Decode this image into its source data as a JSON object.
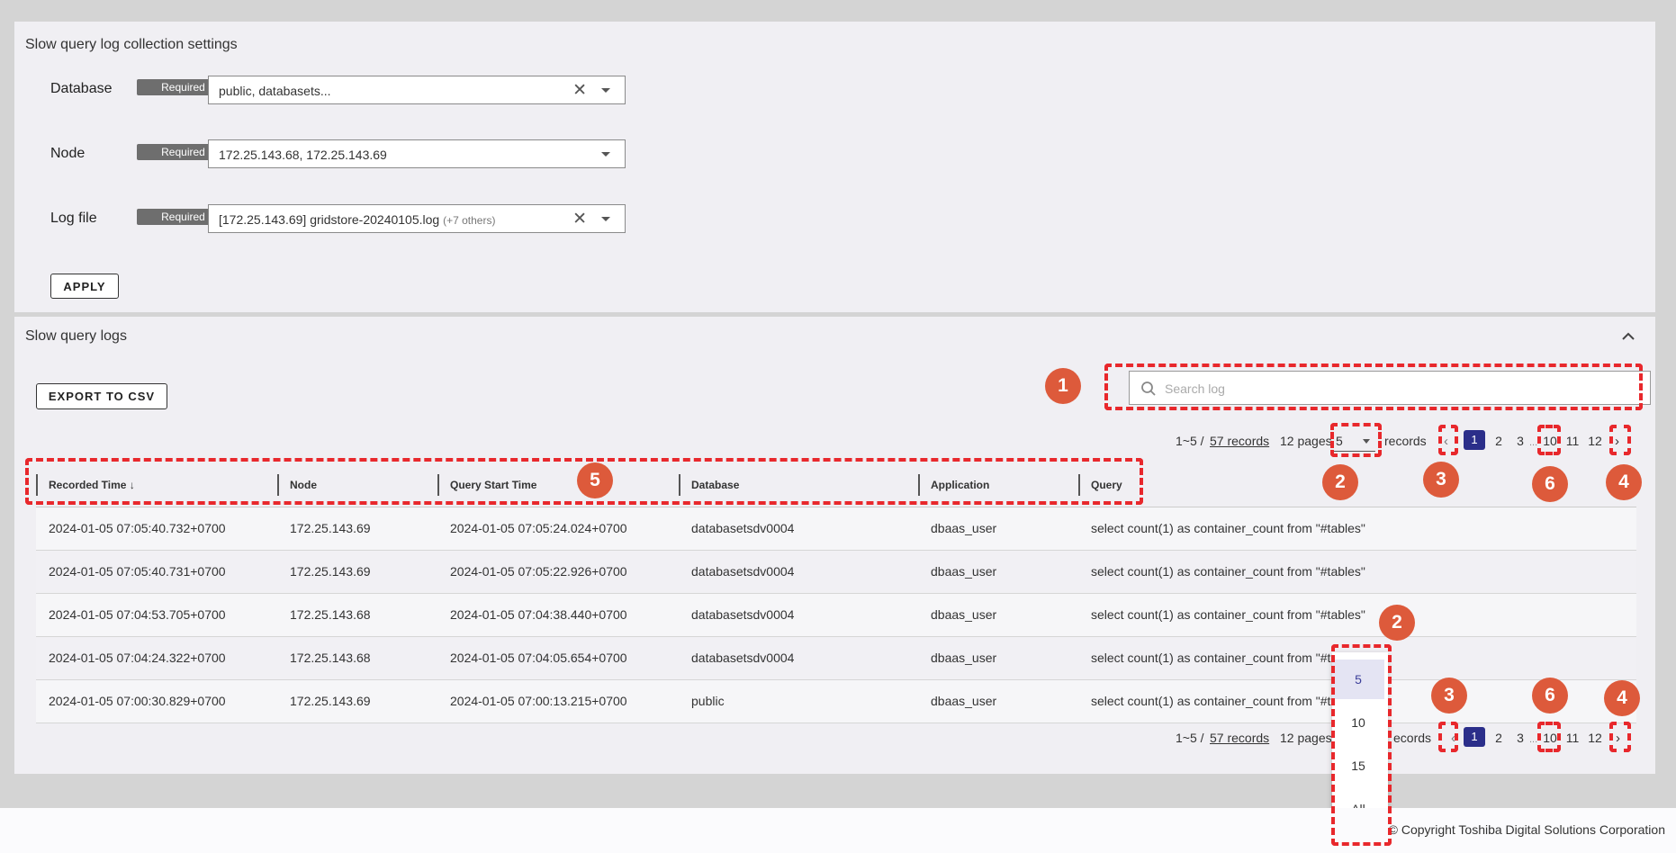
{
  "settings": {
    "title": "Slow query log collection settings",
    "required_badge": "Required",
    "database": {
      "label": "Database",
      "value": "public, databasets..."
    },
    "node": {
      "label": "Node",
      "value": "172.25.143.68, 172.25.143.69"
    },
    "logfile": {
      "label": "Log file",
      "value": "[172.25.143.69] gridstore-20240105.log",
      "extra": "(+7 others)"
    },
    "apply_label": "APPLY"
  },
  "logs": {
    "title": "Slow query logs",
    "export_label": "EXPORT TO CSV",
    "search_placeholder": "Search log",
    "pagination": {
      "range": "1~5 /",
      "records_link": "57 records",
      "pages": "12 pages",
      "page_size": "5",
      "records_label": "records",
      "pages_list": [
        "1",
        "2",
        "3",
        "...",
        "10",
        "11",
        "12"
      ],
      "current_page": "1"
    },
    "columns": [
      "Recorded Time",
      "Node",
      "Query Start Time",
      "Database",
      "Application",
      "Query"
    ],
    "sort_icon": "arrow-down-icon",
    "rows": [
      [
        "2024-01-05 07:05:40.732+0700",
        "172.25.143.69",
        "2024-01-05 07:05:24.024+0700",
        "databasetsdv0004",
        "dbaas_user",
        "select count(1) as container_count from \"#tables\""
      ],
      [
        "2024-01-05 07:05:40.731+0700",
        "172.25.143.69",
        "2024-01-05 07:05:22.926+0700",
        "databasetsdv0004",
        "dbaas_user",
        "select count(1) as container_count from \"#tables\""
      ],
      [
        "2024-01-05 07:04:53.705+0700",
        "172.25.143.68",
        "2024-01-05 07:04:38.440+0700",
        "databasetsdv0004",
        "dbaas_user",
        "select count(1) as container_count from \"#tables\""
      ],
      [
        "2024-01-05 07:04:24.322+0700",
        "172.25.143.68",
        "2024-01-05 07:04:05.654+0700",
        "databasetsdv0004",
        "dbaas_user",
        "select count(1) as container_count from \"#t"
      ],
      [
        "2024-01-05 07:00:30.829+0700",
        "172.25.143.69",
        "2024-01-05 07:00:13.215+0700",
        "public",
        "dbaas_user",
        "select count(1) as container_count from \"#t"
      ]
    ],
    "bottom_records_label": "ecords",
    "page_size_options": [
      "5",
      "10",
      "15",
      "All"
    ]
  },
  "markers": {
    "search": "1",
    "page_size": "2",
    "prev": "3",
    "next": "4",
    "columns": "5",
    "page_jump": "6"
  },
  "colors": {
    "annotation": "#e8282c",
    "marker": "#dd5a3b",
    "active_page": "#2b2e8a"
  },
  "footer": {
    "copyright": "© Copyright Toshiba Digital Solutions Corporation"
  }
}
